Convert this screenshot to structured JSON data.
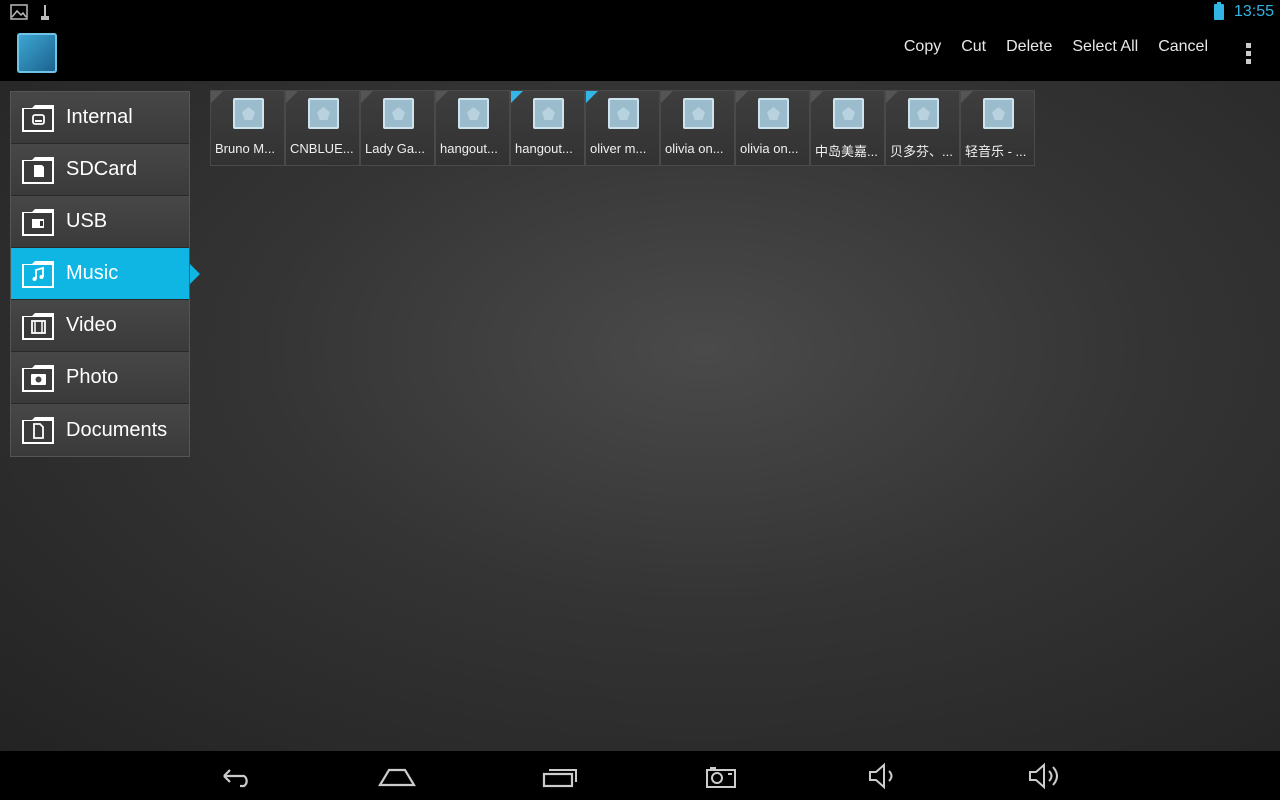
{
  "status_bar": {
    "time": "13:55",
    "notification_icons": [
      "image-icon",
      "usb-icon"
    ],
    "battery_icon": "battery-icon"
  },
  "action_bar": {
    "app_icon": "file-manager-app-icon",
    "actions": [
      "Copy",
      "Cut",
      "Delete",
      "Select All",
      "Cancel"
    ],
    "overflow_icon": "overflow-menu-icon"
  },
  "sidebar": {
    "active_index": 3,
    "items": [
      {
        "label": "Internal",
        "icon": "internal-storage-icon"
      },
      {
        "label": "SDCard",
        "icon": "sdcard-icon"
      },
      {
        "label": "USB",
        "icon": "usb-drive-icon"
      },
      {
        "label": "Music",
        "icon": "music-icon"
      },
      {
        "label": "Video",
        "icon": "video-icon"
      },
      {
        "label": "Photo",
        "icon": "photo-icon"
      },
      {
        "label": "Documents",
        "icon": "documents-icon"
      }
    ]
  },
  "files": [
    {
      "name": "Bruno M...",
      "selected": false
    },
    {
      "name": "CNBLUE...",
      "selected": false
    },
    {
      "name": "Lady Ga...",
      "selected": false
    },
    {
      "name": "hangout...",
      "selected": false
    },
    {
      "name": "hangout...",
      "selected": true
    },
    {
      "name": "oliver m...",
      "selected": true
    },
    {
      "name": "olivia on...",
      "selected": false
    },
    {
      "name": "olivia on...",
      "selected": false
    },
    {
      "name": "中岛美嘉...",
      "selected": false
    },
    {
      "name": "贝多芬、...",
      "selected": false
    },
    {
      "name": "轻音乐 - ...",
      "selected": false
    }
  ],
  "nav_bar": {
    "buttons": [
      "back-icon",
      "home-icon",
      "recent-apps-icon",
      "screenshot-icon",
      "volume-down-icon",
      "volume-up-icon"
    ]
  },
  "colors": {
    "accent": "#33b5e5",
    "active_item": "#0fb6e4"
  }
}
